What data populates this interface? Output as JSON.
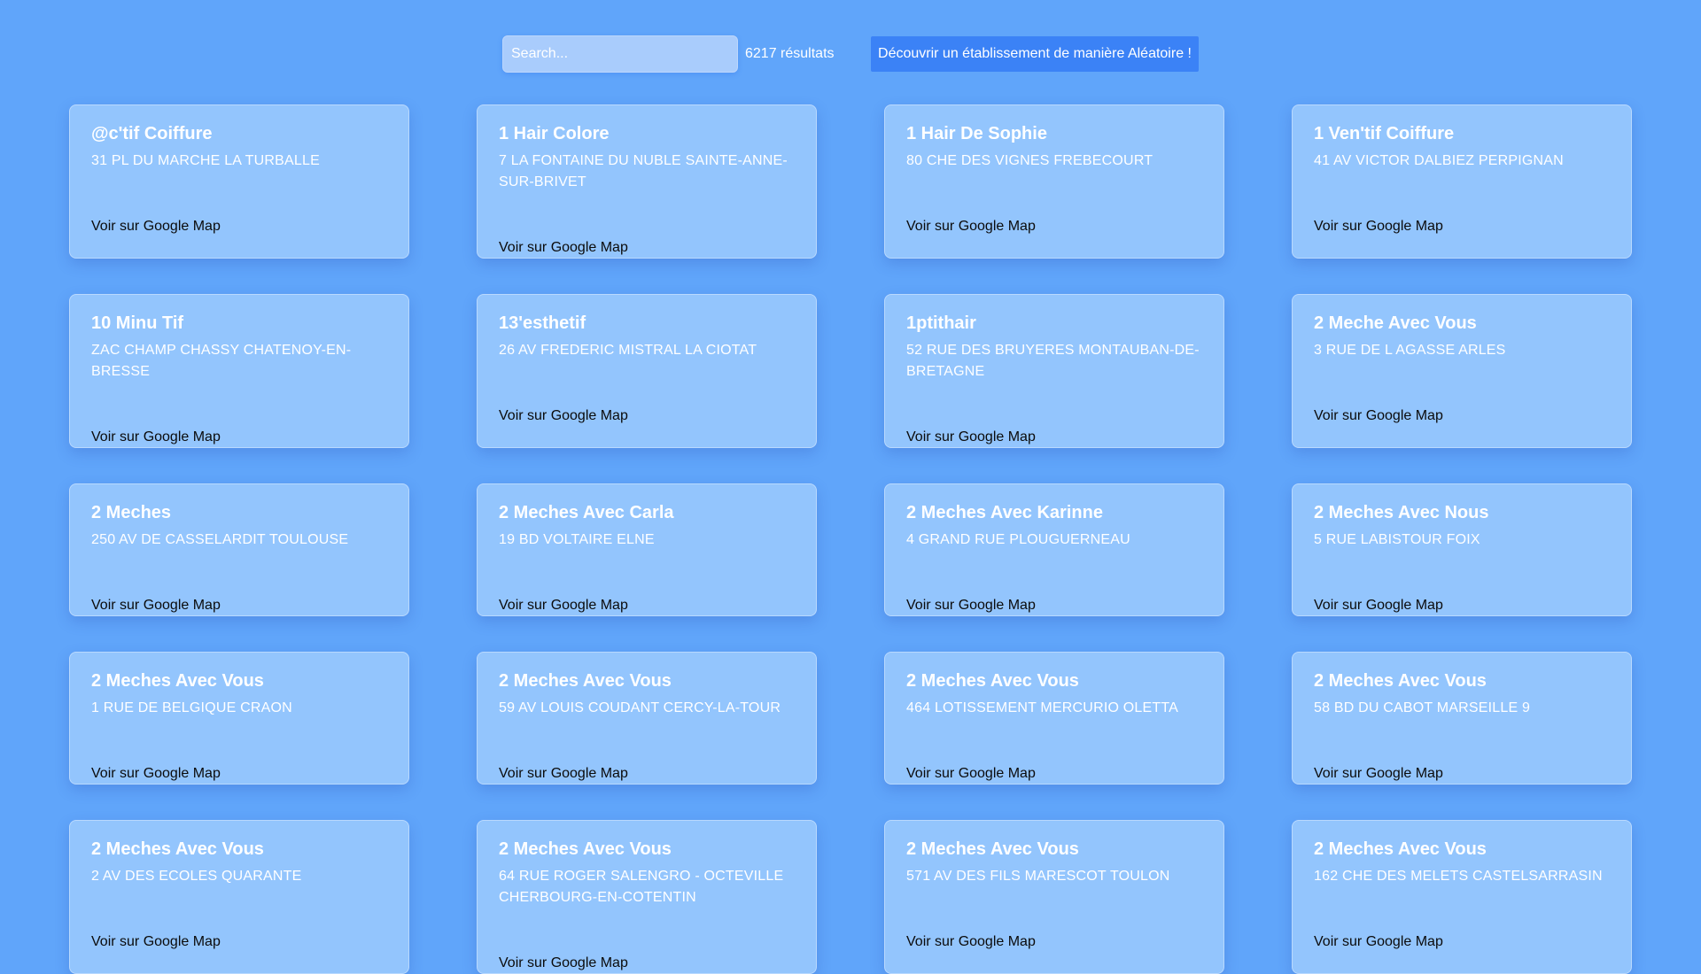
{
  "search": {
    "placeholder": "Search...",
    "value": ""
  },
  "results_label": "6217 résultats",
  "random_button_label": "Découvrir un établissement de manière Aléatoire !",
  "map_link_label": "Voir sur Google Map",
  "colors": {
    "background": "#60a5fa",
    "card": "#93c5fd",
    "button": "#3b82f6"
  },
  "cards": [
    {
      "name": "@c'tif Coiffure",
      "address": "31 PL DU MARCHE LA TURBALLE"
    },
    {
      "name": "1 Hair Colore",
      "address": "7 LA FONTAINE DU NUBLE SAINTE-ANNE-SUR-BRIVET"
    },
    {
      "name": "1 Hair De Sophie",
      "address": "80 CHE DES VIGNES FREBECOURT"
    },
    {
      "name": "1 Ven'tif Coiffure",
      "address": "41 AV VICTOR DALBIEZ PERPIGNAN"
    },
    {
      "name": "10 Minu Tif",
      "address": "ZAC CHAMP CHASSY CHATENOY-EN-BRESSE"
    },
    {
      "name": "13'esthetif",
      "address": "26 AV FREDERIC MISTRAL LA CIOTAT"
    },
    {
      "name": "1ptithair",
      "address": "52 RUE DES BRUYERES MONTAUBAN-DE-BRETAGNE"
    },
    {
      "name": "2 Meche Avec Vous",
      "address": "3 RUE DE L AGASSE ARLES"
    },
    {
      "name": "2 Meches",
      "address": "250 AV DE CASSELARDIT TOULOUSE"
    },
    {
      "name": "2 Meches Avec Carla",
      "address": "19 BD VOLTAIRE ELNE"
    },
    {
      "name": "2 Meches Avec Karinne",
      "address": "4 GRAND RUE PLOUGUERNEAU"
    },
    {
      "name": "2 Meches Avec Nous",
      "address": "5 RUE LABISTOUR FOIX"
    },
    {
      "name": "2 Meches Avec Vous",
      "address": "1 RUE DE BELGIQUE CRAON"
    },
    {
      "name": "2 Meches Avec Vous",
      "address": "59 AV LOUIS COUDANT CERCY-LA-TOUR"
    },
    {
      "name": "2 Meches Avec Vous",
      "address": "464 LOTISSEMENT MERCURIO OLETTA"
    },
    {
      "name": "2 Meches Avec Vous",
      "address": "58 BD DU CABOT MARSEILLE 9"
    },
    {
      "name": "2 Meches Avec Vous",
      "address": "2 AV DES ECOLES QUARANTE"
    },
    {
      "name": "2 Meches Avec Vous",
      "address": "64 RUE ROGER SALENGRO - OCTEVILLE CHERBOURG-EN-COTENTIN"
    },
    {
      "name": "2 Meches Avec Vous",
      "address": "571 AV DES FILS MARESCOT TOULON"
    },
    {
      "name": "2 Meches Avec Vous",
      "address": "162 CHE DES MELETS CASTELSARRASIN"
    }
  ]
}
